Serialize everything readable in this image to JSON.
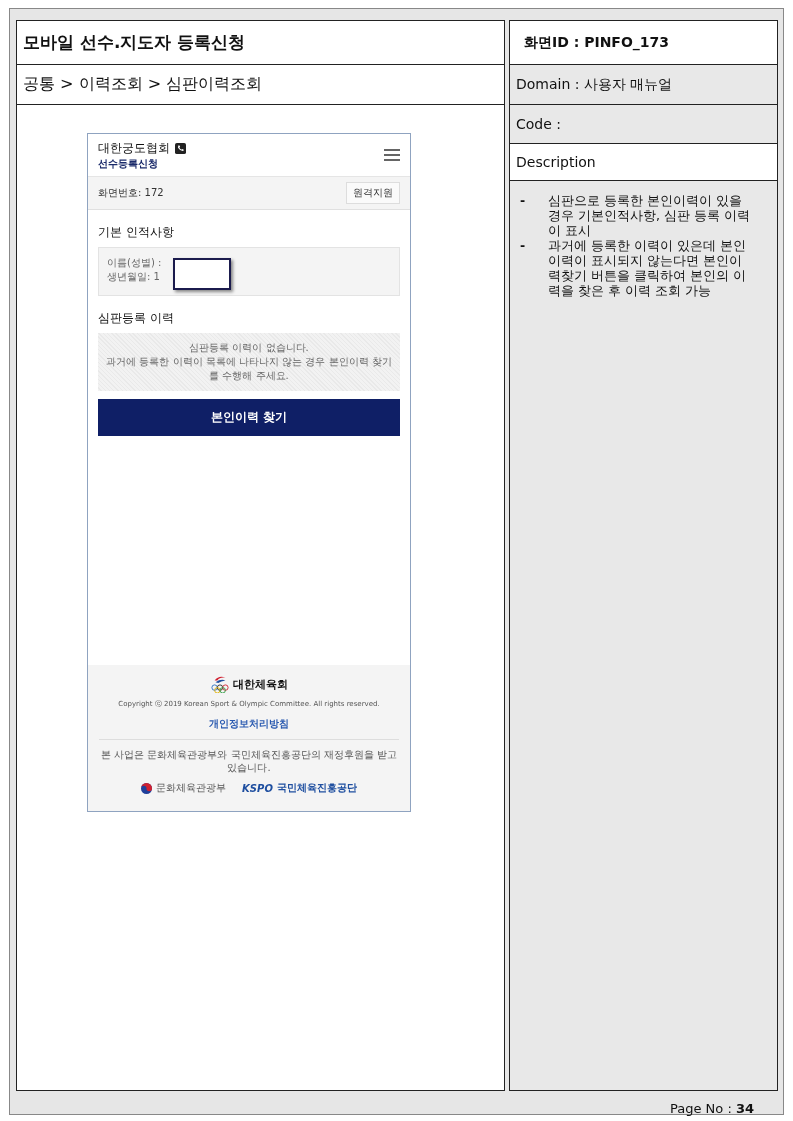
{
  "header": {
    "title": "모바일 선수.지도자 등록신청",
    "screen_id": "화면ID : PINFO_173"
  },
  "breadcrumb": "공통 > 이력조회 > 심판이력조회",
  "meta": {
    "domain": "Domain : 사용자 매뉴얼",
    "code": "Code :",
    "description_label": "Description"
  },
  "description": {
    "bullet": "-",
    "items": [
      "심판으로 등록한 본인이력이 있을 경우 기본인적사항, 심판 등록 이력이 표시",
      "과거에 등록한 이력이 있은데 본인이력이 표시되지 않는다면 본인이력찾기 버튼을 클릭하여 본인의 이력을 찾은 후 이력 조회 가능"
    ]
  },
  "phone": {
    "org_name": "대한궁도협회",
    "subtitle": "선수등록신청",
    "screen_no": "화면번호: 172",
    "remote_button": "원격지원",
    "section_1": "기본 인적사항",
    "info_lines": [
      "이름(성별) :",
      "생년월일: 1"
    ],
    "section_2": "심판등록 이력",
    "empty_lines": [
      "심판등록 이력이 없습니다.",
      "과거에 등록한 이력이 목록에 나타나지 않는 경우 본인이력 찾기를 수행해 주세요."
    ],
    "find_button": "본인이력 찾기",
    "footer": {
      "logo_text": "대한체육회",
      "copyright": "Copyright ⓒ 2019 Korean Sport & Olympic Committee. All rights reserved.",
      "privacy_link": "개인정보처리방침",
      "sponsor": "본 사업은 문화체육관광부와 국민체육진흥공단의 재정후원을 받고 있습니다.",
      "ministry": "문화체육관광부",
      "kspo": "KSPO",
      "kspo_name": "국민체육진흥공단"
    }
  },
  "page_no": "Page No : **34**"
}
